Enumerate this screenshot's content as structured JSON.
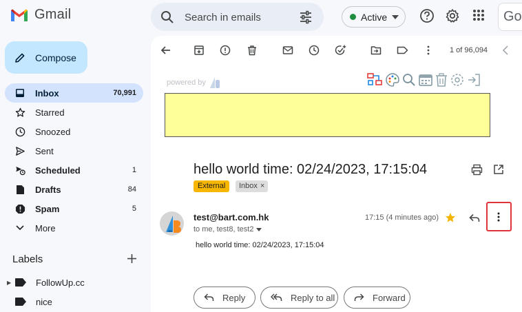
{
  "app": {
    "name": "Gmail",
    "partial_logo": "Go"
  },
  "search": {
    "placeholder": "Search in emails"
  },
  "status": {
    "label": "Active",
    "color": "#1e8e3e"
  },
  "compose": {
    "label": "Compose"
  },
  "nav": [
    {
      "label": "Inbox",
      "count": "70,991",
      "icon": "inbox-icon",
      "selected": true
    },
    {
      "label": "Starred",
      "count": "",
      "icon": "star-outline-icon"
    },
    {
      "label": "Snoozed",
      "count": "",
      "icon": "clock-icon"
    },
    {
      "label": "Sent",
      "count": "",
      "icon": "send-icon"
    },
    {
      "label": "Scheduled",
      "count": "1",
      "icon": "scheduled-send-icon",
      "bold": true
    },
    {
      "label": "Drafts",
      "count": "84",
      "icon": "draft-icon",
      "bold": true
    },
    {
      "label": "Spam",
      "count": "5",
      "icon": "spam-icon",
      "bold": true
    },
    {
      "label": "More",
      "count": "",
      "icon": "chevron-down-icon"
    }
  ],
  "labels": {
    "title": "Labels",
    "items": [
      {
        "label": "FollowUp.cc"
      },
      {
        "label": "nice"
      }
    ]
  },
  "toolbar": {
    "pager": "1 of 96,094"
  },
  "addon": {
    "powered_by": "powered by"
  },
  "email": {
    "subject": "hello world time: 02/24/2023, 17:15:04",
    "chips": {
      "external": "External",
      "inbox": "Inbox",
      "inbox_remove": "×"
    },
    "sender": "test@bart.com.hk",
    "recipients": "to me, test8, test2",
    "time": "17:15 (4 minutes ago)",
    "body": "hello world time: 02/24/2023, 17:15:04"
  },
  "actions": {
    "reply": "Reply",
    "reply_all": "Reply to all",
    "forward": "Forward"
  },
  "colors": {
    "compose_bg": "#c2e7ff",
    "selected_nav": "#d3e3fd",
    "banner": "#ffff99",
    "external_chip": "#f7b600",
    "highlight_border": "#e0333b"
  }
}
